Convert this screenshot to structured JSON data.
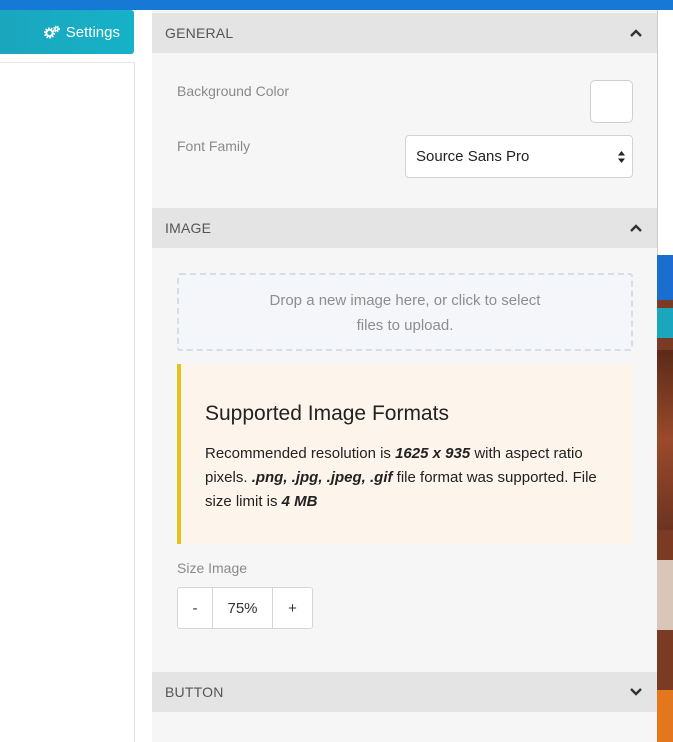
{
  "sidebar": {
    "settings_label": "Settings",
    "settings_icon": "gears-icon"
  },
  "general": {
    "title": "GENERAL",
    "background_color_label": "Background Color",
    "background_color_value": "#ffffff",
    "font_family_label": "Font Family",
    "font_family_value": "Source Sans Pro"
  },
  "image": {
    "title": "IMAGE",
    "dropzone_line1": "Drop a new image here, or click to select",
    "dropzone_line2": "files to upload.",
    "info_title": "Supported Image Formats",
    "info_text_1": "Recommended resolution is ",
    "info_resolution": "1625 x 935",
    "info_text_2": " with aspect ratio pixels. ",
    "info_formats": ".png, .jpg, .jpeg, .gif",
    "info_text_3": " file format was supported. File size limit is ",
    "info_size_limit": "4 MB",
    "size_label": "Size Image",
    "size_minus": "-",
    "size_value": "75%",
    "size_plus": "+"
  },
  "button": {
    "title": "BUTTON"
  },
  "colors": {
    "accent_top_bar": "#1679d6",
    "settings_button": "#1aa6bd",
    "info_border": "#e3c219",
    "info_background": "#fdf4ec"
  }
}
